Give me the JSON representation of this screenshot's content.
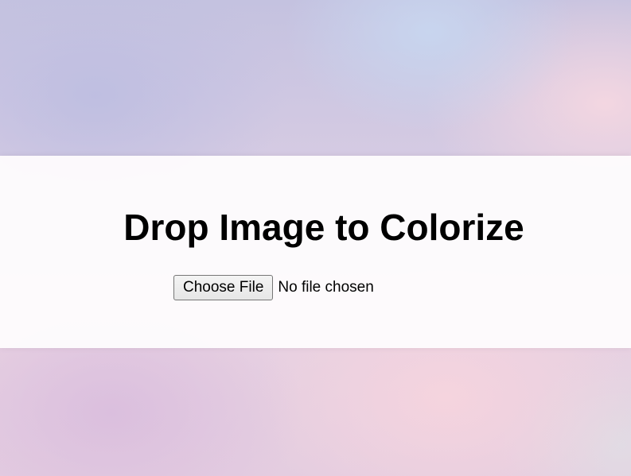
{
  "drop_zone": {
    "title": "Drop Image to Colorize",
    "file_input": {
      "button_label": "Choose File",
      "status_text": "No file chosen"
    }
  },
  "colors": {
    "panel_background": "#fdfbfd",
    "text": "#000000",
    "background_tones": [
      "#c4c2e0",
      "#c8d7f0",
      "#f5d7e1",
      "#dabede",
      "#f6d4de"
    ]
  }
}
